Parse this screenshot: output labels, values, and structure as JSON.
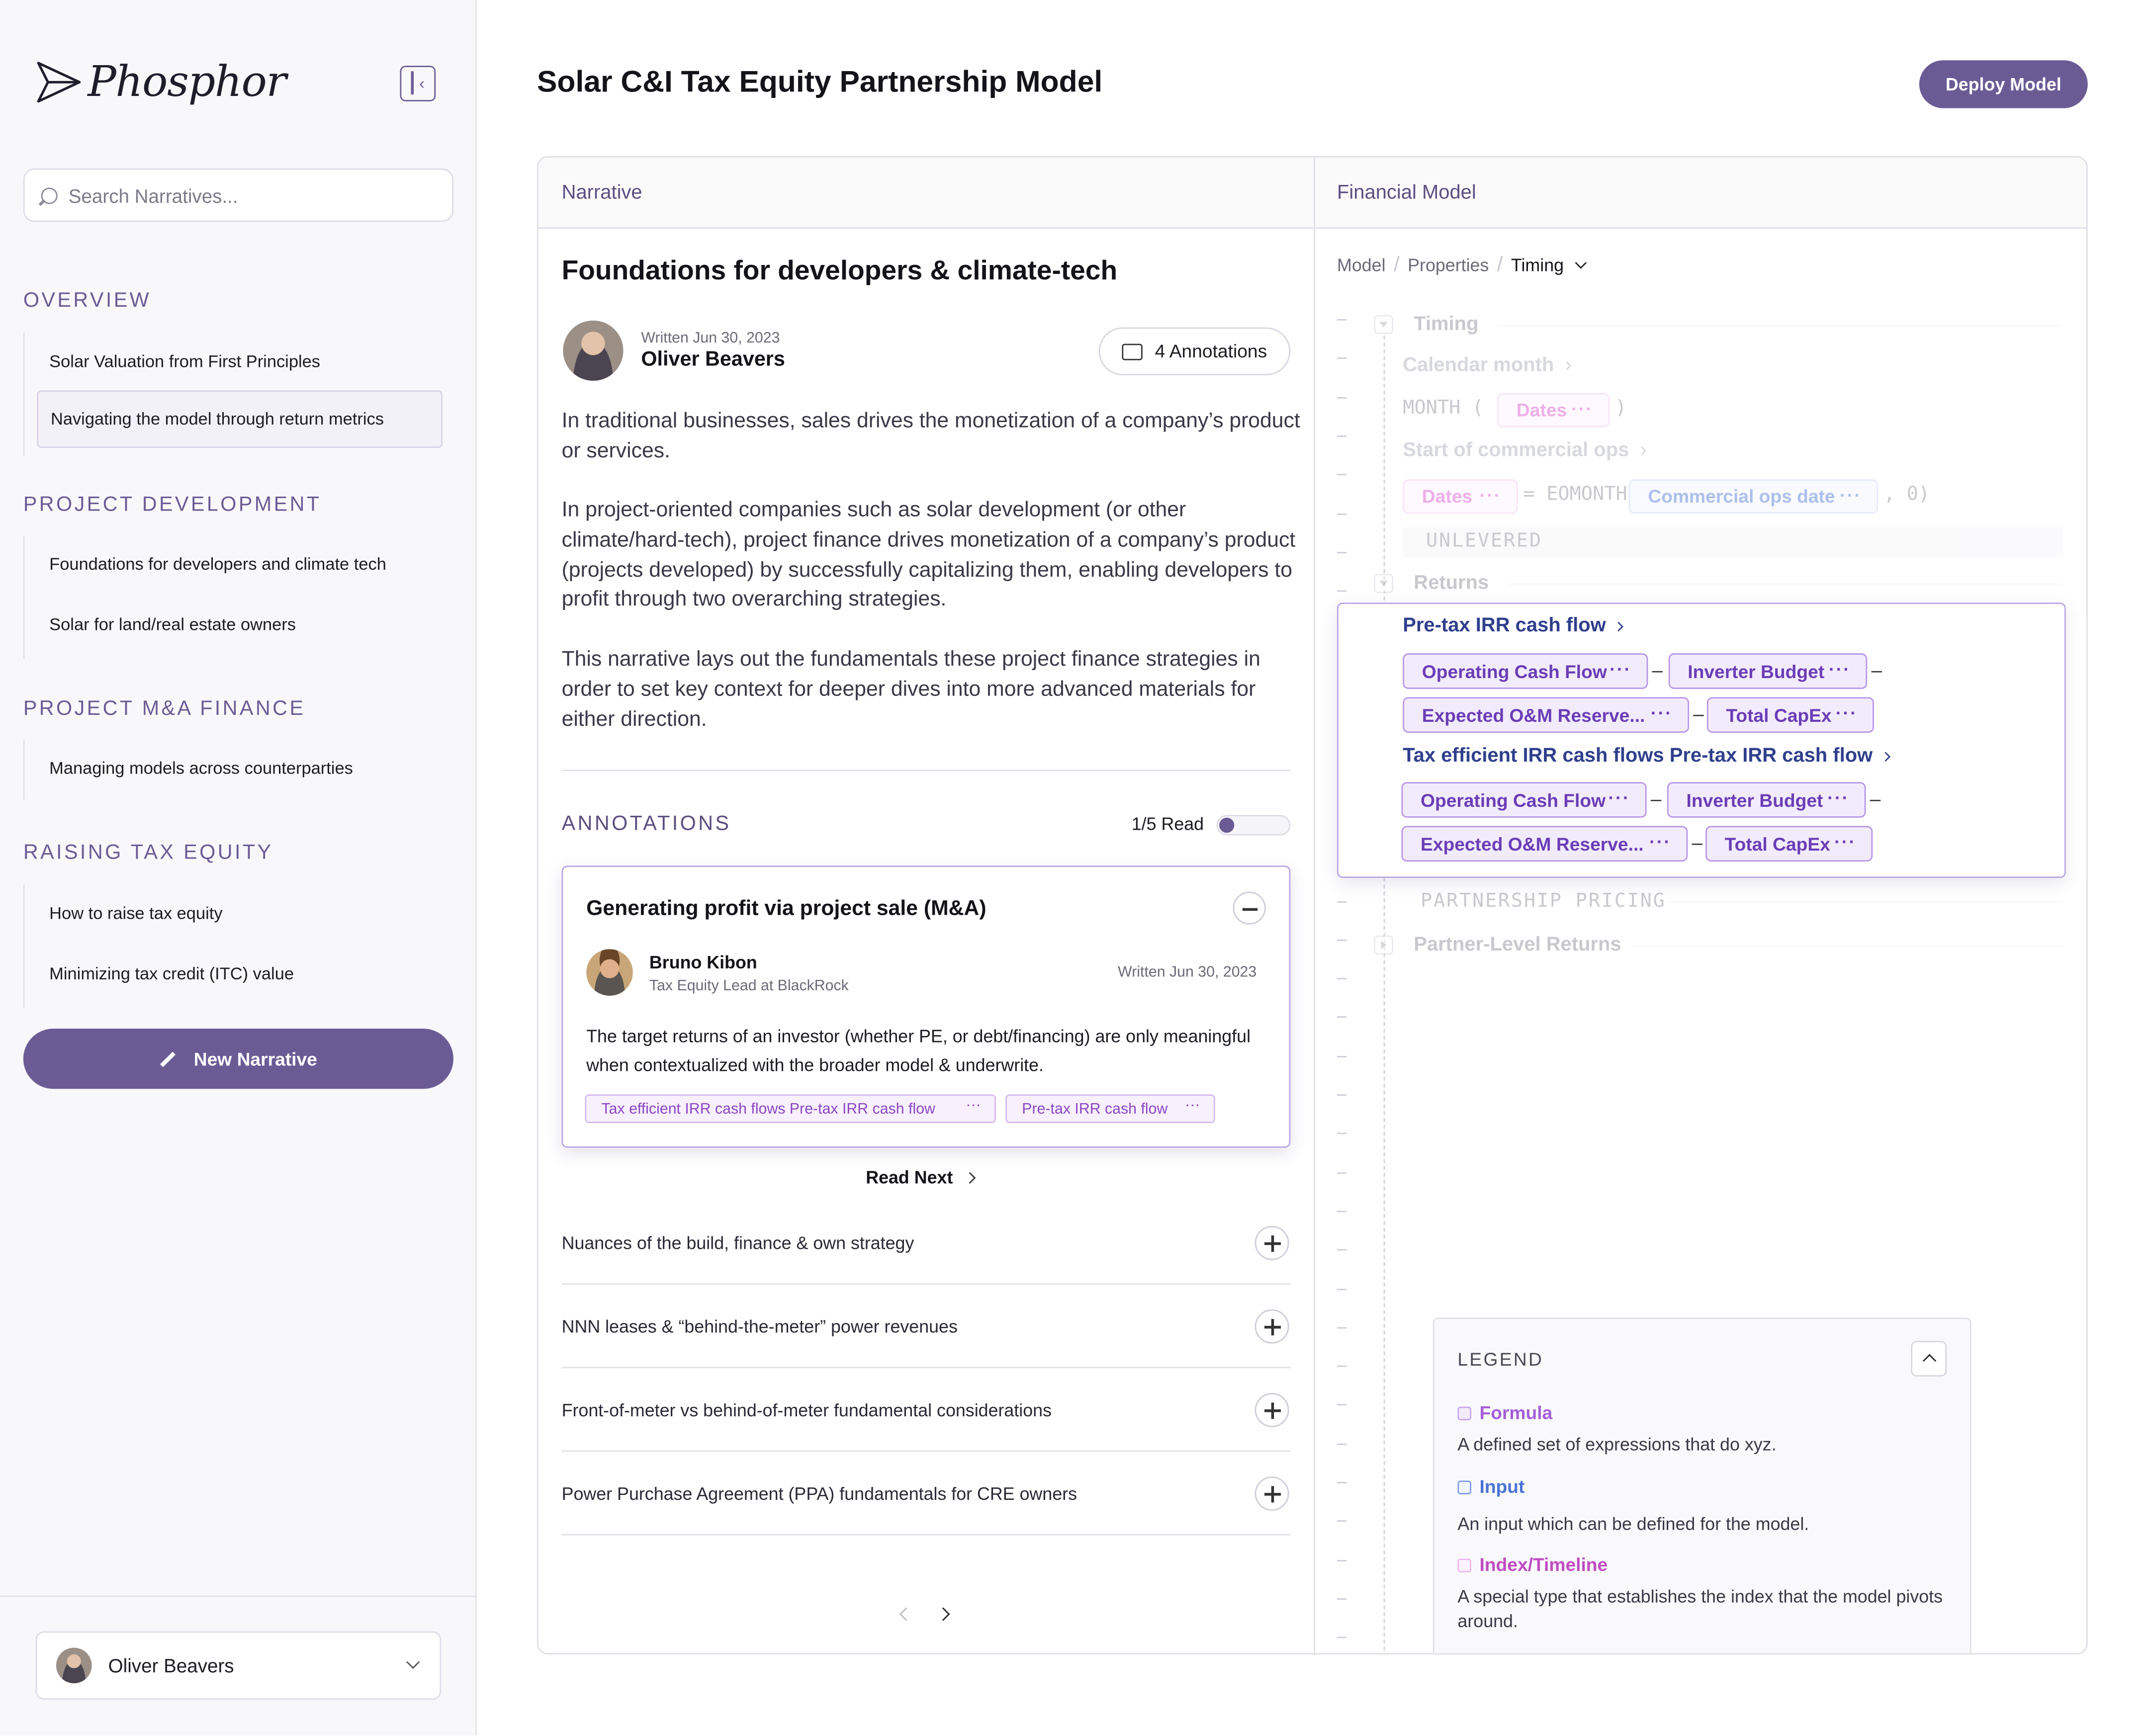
{
  "app": {
    "brand": "Phosphor"
  },
  "sidebar": {
    "search_placeholder": "Search Narratives...",
    "sections": [
      {
        "title": "OVERVIEW",
        "items": [
          "Solar Valuation from First Principles",
          "Navigating the model through return metrics"
        ]
      },
      {
        "title": "PROJECT DEVELOPMENT",
        "items": [
          "Foundations for developers and climate tech",
          "Solar for land/real estate owners"
        ]
      },
      {
        "title": "PROJECT M&A FINANCE",
        "items": [
          "Managing models across counterparties"
        ]
      },
      {
        "title": "RAISING TAX EQUITY",
        "items": [
          "How to raise tax equity",
          "Minimizing tax credit  (ITC) value"
        ]
      }
    ],
    "active_item": "Navigating the model through return metrics",
    "new_narrative_label": "New Narrative",
    "user_name": "Oliver Beavers"
  },
  "header": {
    "title": "Solar C&I Tax Equity Partnership Model",
    "deploy_label": "Deploy Model"
  },
  "narrative": {
    "panel_label": "Narrative",
    "title": "Foundations for developers & climate-tech",
    "written": "Written Jun 30, 2023",
    "author": "Oliver Beavers",
    "annotations_button": "4 Annotations",
    "paragraphs": [
      "In traditional businesses, sales drives the monetization of a company’s product or services.",
      "In project-oriented companies such as solar development (or other climate/hard-tech), project finance drives monetization of a company’s product (projects developed) by successfully capitalizing them, enabling developers to profit through two overarching strategies.",
      "This narrative lays out the fundamentals these project finance strategies in order to set key context for deeper dives into more advanced materials for either direction."
    ],
    "annotations": {
      "heading": "ANNOTATIONS",
      "read_count": "1/5 Read",
      "read_progress": 0.2,
      "card": {
        "title": "Generating profit via project sale (M&A)",
        "author": "Bruno Kibon",
        "role": "Tax Equity Lead at BlackRock",
        "date": "Written Jun 30, 2023",
        "text": "The target returns of an investor (whether PE, or debt/financing) are only meaningful when contextualized with the broader model & underwrite.",
        "tags": [
          "Tax efficient IRR cash flows Pre-tax IRR cash flow",
          "Pre-tax IRR cash flow"
        ]
      },
      "read_next": "Read Next",
      "items": [
        "Nuances of the build, finance & own strategy",
        "NNN leases & “behind-the-meter” power revenues",
        "Front-of-meter vs behind-of-meter fundamental considerations",
        "Power Purchase Agreement (PPA) fundamentals for CRE owners"
      ]
    }
  },
  "model": {
    "panel_label": "Financial Model",
    "breadcrumbs": [
      "Model",
      "Properties",
      "Timing"
    ],
    "timing": {
      "heading": "Timing",
      "calendar_month": "Calendar month",
      "month_fn": "MONTH (",
      "dates_chip": "Dates",
      "close_paren": ")",
      "start_commercial": "Start of commercial ops",
      "eomonth": "= EOMONTH",
      "commercial_ops_chip": "Commercial ops date",
      "zero_arg": ", 0)"
    },
    "unlevered": "UNLEVERED",
    "returns": {
      "heading": "Returns",
      "pretax_link": "Pre-tax IRR cash flow",
      "tax_eff_link": "Tax efficient IRR cash flows Pre-tax IRR cash flow",
      "chips": {
        "operating": "Operating Cash Flow",
        "inverter": "Inverter Budget",
        "om_reserve": "Expected O&M Reserve...",
        "capex": "Total CapEx"
      },
      "minus": "–"
    },
    "partnership_pricing": "PARTNERSHIP PRICING",
    "partner_returns": "Partner-Level Returns",
    "legend": {
      "title": "LEGEND",
      "items": [
        {
          "key": "Formula",
          "desc": "A defined set of expressions that do xyz.",
          "color": "#a45ed9"
        },
        {
          "key": "Input",
          "desc": "An input which can be defined for the model.",
          "color": "#4a73d6"
        },
        {
          "key": "Index/Timeline",
          "desc": "A special type that establishes the index that the model pivots around.",
          "color": "#c04bc2"
        }
      ]
    }
  },
  "colors": {
    "accent": "#6b5b95",
    "formula": "#6a3db6",
    "input": "#4a73d6",
    "index": "#d84fd0"
  }
}
